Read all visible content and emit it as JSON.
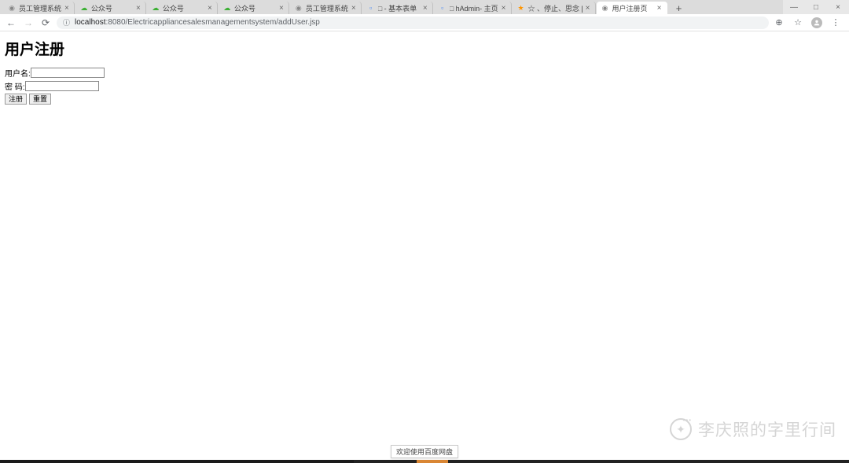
{
  "window_controls": {
    "minimize": "—",
    "maximize": "□",
    "close": "×"
  },
  "tabs": [
    {
      "icon": "globe",
      "title": "员工管理系统"
    },
    {
      "icon": "green",
      "title": "公众号"
    },
    {
      "icon": "green",
      "title": "公众号"
    },
    {
      "icon": "green",
      "title": "公众号"
    },
    {
      "icon": "globe",
      "title": "员工管理系统"
    },
    {
      "icon": "blue",
      "title": "□ - 基本表单"
    },
    {
      "icon": "blue",
      "title": "□ hAdmin- 主页"
    },
    {
      "icon": "orange",
      "title": "☆ 、停止、思念 [http://"
    },
    {
      "icon": "globe",
      "title": "用户注册页",
      "active": true
    }
  ],
  "new_tab_label": "+",
  "address": {
    "info_icon": "ⓘ",
    "host": "localhost",
    "port": ":8080",
    "path": "/Electricappliancesalesmanagementsystem/addUser.jsp"
  },
  "toolbar_icons": {
    "search": "⊕",
    "star": "☆",
    "menu": "⋮"
  },
  "page": {
    "title": "用户注册",
    "username_label": "用户名:",
    "password_label": "密 码:",
    "username_value": "",
    "password_value": "",
    "submit_label": "注册",
    "reset_label": "重置"
  },
  "tooltip": "欢迎使用百度网盘",
  "watermark": "李庆照的字里行间"
}
